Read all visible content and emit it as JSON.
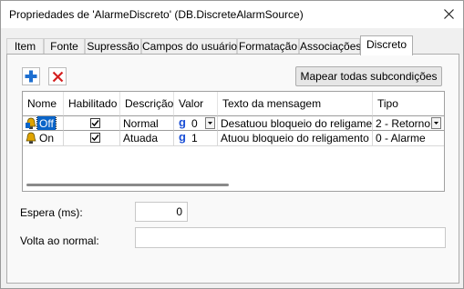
{
  "window": {
    "title": "Propriedades de 'AlarmeDiscreto' (DB.DiscreteAlarmSource)",
    "close_icon": "close-icon"
  },
  "tabs": [
    {
      "label": "Item",
      "active": false
    },
    {
      "label": "Fonte",
      "active": false
    },
    {
      "label": "Supressão",
      "active": false
    },
    {
      "label": "Campos do usuário",
      "active": false
    },
    {
      "label": "Formatação",
      "active": false
    },
    {
      "label": "Associações",
      "active": false
    },
    {
      "label": "Discreto",
      "active": true
    }
  ],
  "toolbar": {
    "add_icon": "plus-icon",
    "remove_icon": "delete-x-icon",
    "map_button_label": "Mapear todas subcondições"
  },
  "grid": {
    "columns": [
      "Nome",
      "Habilitado",
      "Descrição",
      "Valor",
      "Texto da mensagem",
      "Tipo"
    ],
    "rows": [
      {
        "name": "Off",
        "enabled": true,
        "description": "Normal",
        "value_icon": "g",
        "value": "0",
        "message": "Desatuou bloqueio do religamento",
        "type": "2 - Retorno",
        "selected": true
      },
      {
        "name": "On",
        "enabled": true,
        "description": "Atuada",
        "value_icon": "g",
        "value": "1",
        "message": "Atuou bloqueio do religamento",
        "type": "0 - Alarme",
        "selected": false
      }
    ]
  },
  "fields": {
    "delay_label": "Espera (ms):",
    "delay_value": "0",
    "return_label": "Volta ao normal:",
    "return_value": ""
  },
  "colors": {
    "accent": "#0a64c8",
    "add_icon": "#1e6fd0",
    "remove_icon": "#d42020"
  }
}
